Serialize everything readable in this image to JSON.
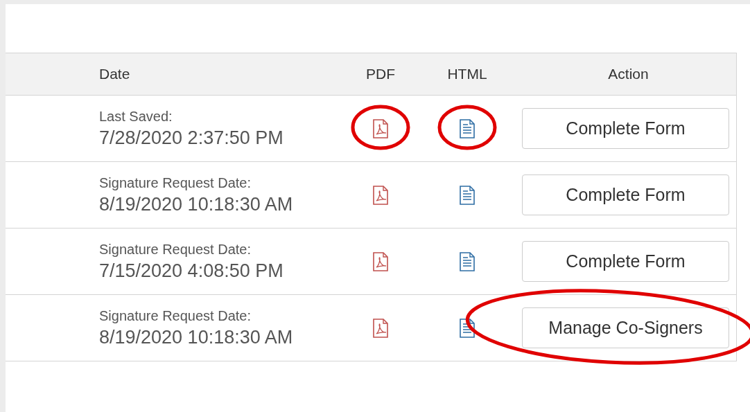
{
  "table": {
    "columns": [
      {
        "label": "Date",
        "kind": "date"
      },
      {
        "label": "PDF",
        "kind": "pdf"
      },
      {
        "label": "HTML",
        "kind": "html"
      },
      {
        "label": "Action",
        "kind": "action"
      }
    ],
    "rows": [
      {
        "date_label": "Last Saved:",
        "date": "7/28/2020 2:37:50 PM",
        "pdf_circled": true,
        "html_circled": true,
        "action": {
          "label": "Complete Form",
          "circled": false
        }
      },
      {
        "date_label": "Signature Request Date:",
        "date": "8/19/2020 10:18:30 AM",
        "pdf_circled": false,
        "html_circled": false,
        "action": {
          "label": "Complete Form",
          "circled": false
        }
      },
      {
        "date_label": "Signature Request Date:",
        "date": "7/15/2020 4:08:50 PM",
        "pdf_circled": false,
        "html_circled": false,
        "action": {
          "label": "Complete Form",
          "circled": false
        }
      },
      {
        "date_label": "Signature Request Date:",
        "date": "8/19/2020 10:18:30 AM",
        "pdf_circled": false,
        "html_circled": false,
        "action": {
          "label": "Manage Co-Signers",
          "circled": true
        }
      }
    ]
  }
}
